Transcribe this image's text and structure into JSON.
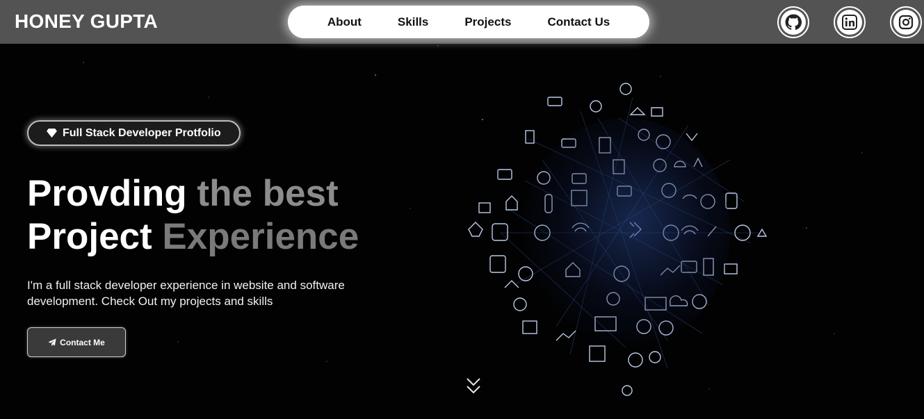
{
  "header": {
    "brand": "HONEY GUPTA",
    "nav": [
      {
        "label": "About"
      },
      {
        "label": "Skills"
      },
      {
        "label": "Projects"
      },
      {
        "label": "Contact Us"
      }
    ],
    "social": [
      {
        "icon": "github-icon"
      },
      {
        "icon": "linkedin-icon"
      },
      {
        "icon": "instagram-icon"
      }
    ]
  },
  "hero": {
    "badge": "Full Stack Developer Protfolio",
    "headline": {
      "line1_part1": "Provding",
      "line1_part2": "the best",
      "line2_part1": "Project",
      "line2_part2": "Experience"
    },
    "intro": "I'm a full stack developer experience in website and software development. Check Out my projects and skills",
    "cta_label": "Contact Me"
  },
  "colors": {
    "header_bg": "#535353",
    "page_bg": "#020203",
    "muted_text": "#8c8c8c",
    "globe_accent": "#6fa8ff"
  }
}
